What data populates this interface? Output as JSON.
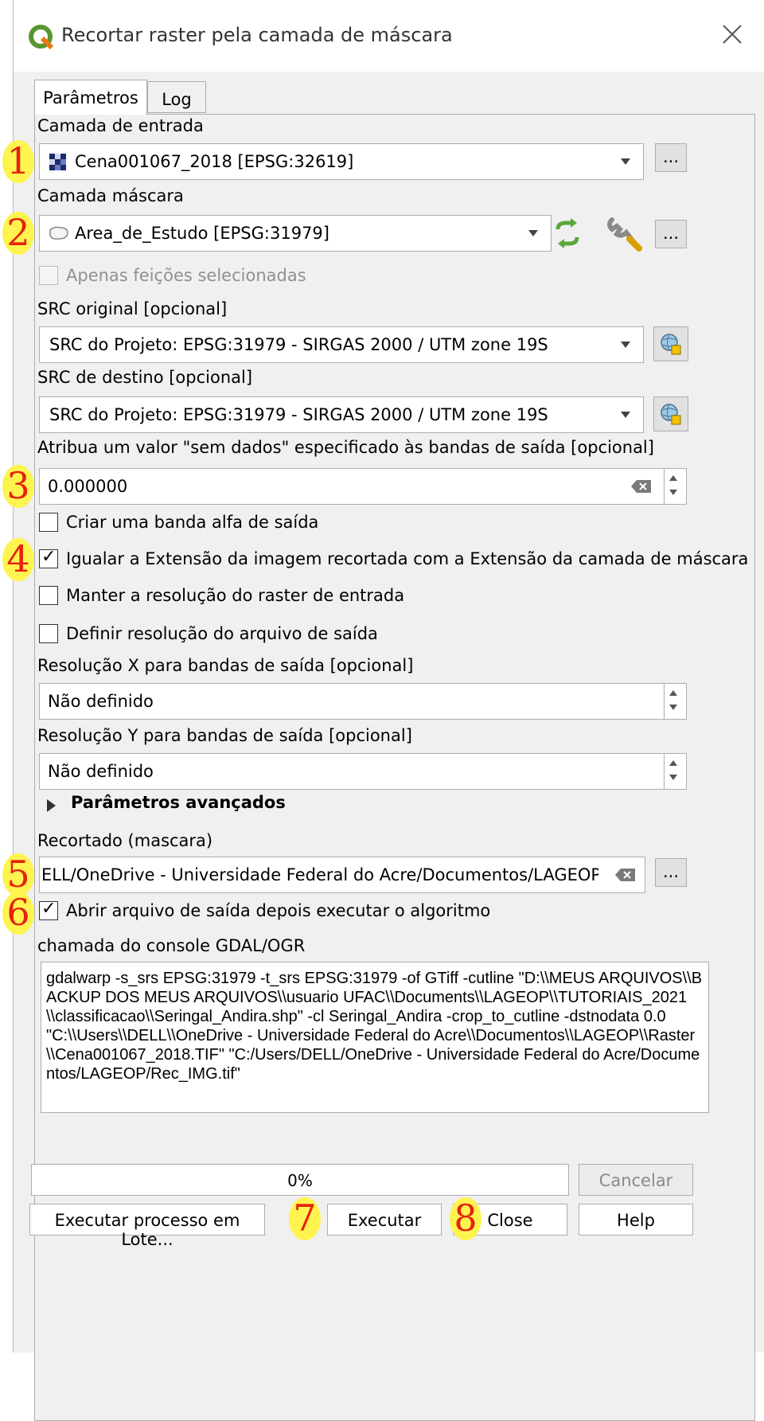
{
  "window": {
    "title": "Recortar raster pela camada de máscara"
  },
  "tabs": [
    {
      "label": "Parâmetros"
    },
    {
      "label": "Log"
    }
  ],
  "input_layer": {
    "label": "Camada de entrada",
    "value": "Cena001067_2018 [EPSG:32619]",
    "browse": "..."
  },
  "mask_layer": {
    "label": "Camada máscara",
    "value": "Area_de_Estudo [EPSG:31979]",
    "browse": "...",
    "selected_only": "Apenas feições selecionadas"
  },
  "src_original": {
    "label": "SRC original [opcional]",
    "value": "SRC do Projeto: EPSG:31979 - SIRGAS 2000 / UTM zone 19S"
  },
  "src_destino": {
    "label": "SRC de destino [opcional]",
    "value": "SRC do Projeto: EPSG:31979 - SIRGAS 2000 / UTM zone 19S"
  },
  "nodata": {
    "label": "Atribua um valor \"sem dados\" especificado às bandas de saída [opcional]",
    "value": "0.000000"
  },
  "checkboxes": {
    "alpha": "Criar uma banda alfa de saída",
    "extent": "Igualar a Extensão da imagem recortada com a Extensão da camada de máscara",
    "keep_res": "Manter a resolução do raster de entrada",
    "set_res": "Definir resolução do arquivo de saída"
  },
  "res_x": {
    "label": "Resolução X para bandas de saída [opcional]",
    "value": "Não definido"
  },
  "res_y": {
    "label": "Resolução Y para bandas de saída [opcional]",
    "value": "Não definido"
  },
  "advanced": {
    "label": "Parâmetros avançados"
  },
  "output": {
    "label": "Recortado (mascara)",
    "value": "ELL/OneDrive - Universidade Federal do Acre/Documentos/LAGEOP/Rec_IMG.tif",
    "browse": "..."
  },
  "open_output": "Abrir arquivo de saída depois executar o algoritmo",
  "gdal": {
    "label": "chamada do console GDAL/OGR",
    "command": "gdalwarp -s_srs EPSG:31979 -t_srs EPSG:31979 -of GTiff -cutline \"D:\\\\MEUS ARQUIVOS\\\\BACKUP DOS MEUS ARQUIVOS\\\\usuario UFAC\\\\Documents\\\\LAGEOP\\\\TUTORIAIS_2021\\\\classificacao\\\\Seringal_Andira.shp\" -cl Seringal_Andira -crop_to_cutline -dstnodata 0.0 \"C:\\\\Users\\\\DELL\\\\OneDrive - Universidade Federal do Acre\\\\Documentos\\\\LAGEOP\\\\Raster\\\\Cena001067_2018.TIF\" \"C:/Users/DELL/OneDrive - Universidade Federal do Acre/Documentos/LAGEOP/Rec_IMG.tif\""
  },
  "progress": {
    "text": "0%",
    "value": 0
  },
  "buttons": {
    "cancel": "Cancelar",
    "batch": "Executar processo em Lote...",
    "run": "Executar",
    "close": "Close",
    "help": "Help"
  },
  "annotations": [
    "1",
    "2",
    "3",
    "4",
    "5",
    "6",
    "7",
    "8"
  ]
}
